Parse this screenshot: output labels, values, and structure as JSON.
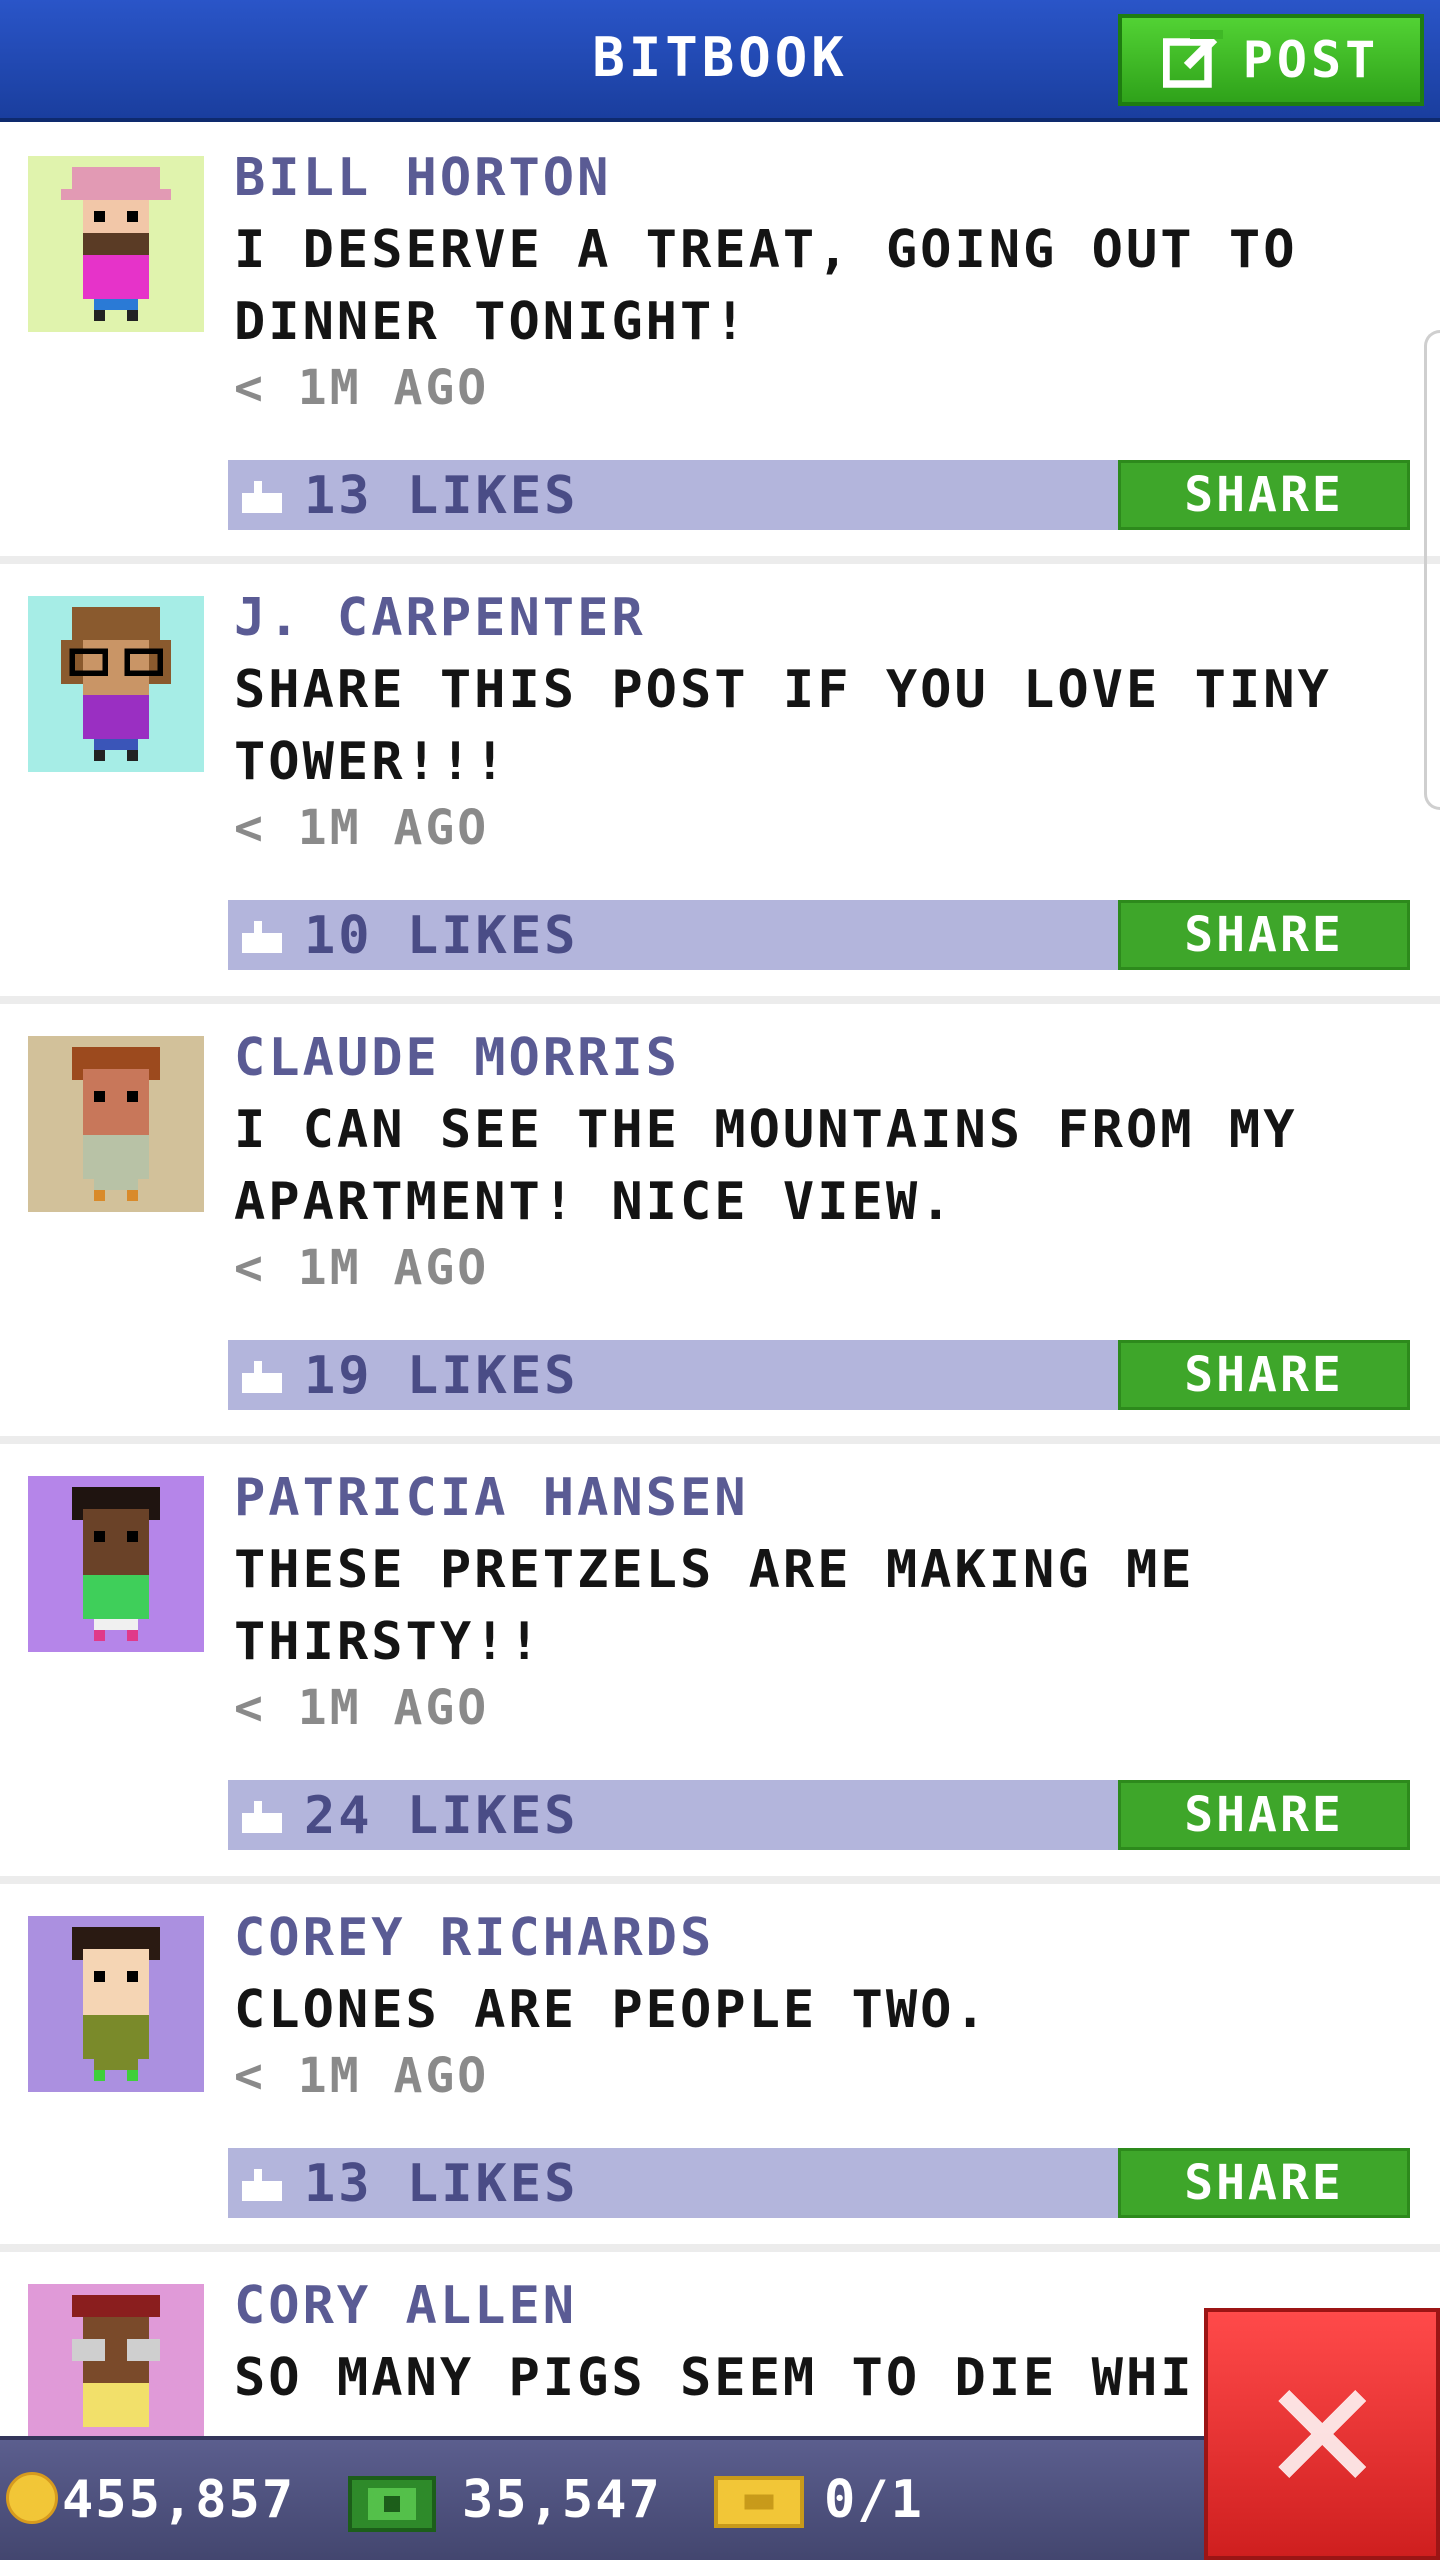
{
  "header": {
    "title": "BITBOOK",
    "post_label": "POST"
  },
  "posts": [
    {
      "author": "BILL HORTON",
      "message": "I DESERVE A TREAT, GOING OUT TO DINNER TONIGHT!",
      "time": "< 1M AGO",
      "likes": "13 LIKES",
      "share": "SHARE",
      "avatar_bg": "#e0f3ad"
    },
    {
      "author": "J. CARPENTER",
      "message": "SHARE THIS POST IF YOU LOVE TINY TOWER!!!",
      "time": "< 1M AGO",
      "likes": "10 LIKES",
      "share": "SHARE",
      "avatar_bg": "#a6ede6"
    },
    {
      "author": "CLAUDE MORRIS",
      "message": "I CAN SEE THE MOUNTAINS FROM MY APARTMENT! NICE VIEW.",
      "time": "< 1M AGO",
      "likes": "19 LIKES",
      "share": "SHARE",
      "avatar_bg": "#d2c19a"
    },
    {
      "author": "PATRICIA HANSEN",
      "message": "THESE PRETZELS ARE MAKING ME THIRSTY!!",
      "time": "< 1M AGO",
      "likes": "24 LIKES",
      "share": "SHARE",
      "avatar_bg": "#b585e9"
    },
    {
      "author": "COREY RICHARDS",
      "message": "CLONES ARE PEOPLE TWO.",
      "time": "< 1M AGO",
      "likes": "13 LIKES",
      "share": "SHARE",
      "avatar_bg": "#ab90e0"
    },
    {
      "author": "CORY ALLEN",
      "message": "SO MANY PIGS SEEM TO DIE WHI",
      "time": "",
      "likes": "",
      "share": "",
      "avatar_bg": "#e09ad8"
    }
  ],
  "footer": {
    "coins": "455,857",
    "bux": "35,547",
    "tickets": "0/1"
  },
  "colors": {
    "header": "#1a3e9e",
    "post_button": "#3ea62a",
    "likes_bar": "#b3b5dc",
    "author": "#5a5b94",
    "close": "#cf1f1f"
  }
}
